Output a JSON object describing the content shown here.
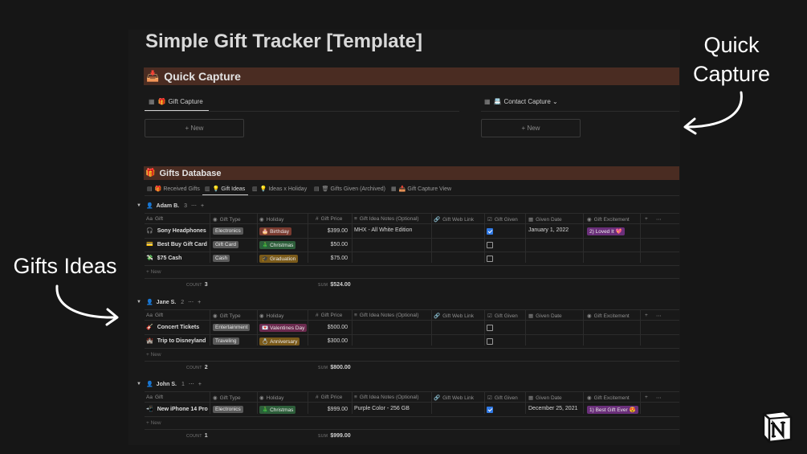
{
  "page": {
    "title": "Simple Gift Tracker [Template]"
  },
  "quick_capture": {
    "heading": "Quick Capture",
    "heading_emoji": "📥",
    "views": [
      {
        "icon": "board-view-icon",
        "emoji": "🎁",
        "label": "Gift Capture",
        "new_label": "+ New"
      },
      {
        "icon": "board-view-icon",
        "emoji": "📇",
        "label": "Contact Capture ⌄",
        "new_label": "+ New"
      }
    ]
  },
  "gifts_database": {
    "heading": "Gifts Database",
    "heading_emoji": "🎁",
    "tabs": [
      {
        "emoji": "🎁",
        "label": "Received Gifts",
        "active": false
      },
      {
        "emoji": "💡",
        "label": "Gift Ideas",
        "active": true
      },
      {
        "emoji": "💡",
        "label": "Ideas x Holiday",
        "active": false
      },
      {
        "emoji": "🗑",
        "label": "Gifts Given (Archived)",
        "active": false
      },
      {
        "emoji": "📥",
        "label": "Gift Capture View",
        "active": false
      }
    ],
    "columns": [
      "Gift",
      "Gift Type",
      "Holiday",
      "Gift Price",
      "Gift Idea Notes (Optional)",
      "Gift Web Link",
      "Gift Given",
      "Given Date",
      "Gift Excitement"
    ],
    "column_prefixes": [
      "Aa",
      "◉",
      "◉",
      "#",
      "≡",
      "🔗",
      "☑",
      "▦",
      "◉"
    ],
    "new_row_label": "+ New",
    "count_label": "COUNT",
    "sum_label": "SUM",
    "groups": [
      {
        "name": "Adam B.",
        "count": "3",
        "rows": [
          {
            "emoji": "🎧",
            "gift": "Sony Headphones",
            "type": "Electronics",
            "holiday_emoji": "🎂",
            "holiday": "Birthday",
            "price": "$399.00",
            "notes": "MHX - All White Edition",
            "given": true,
            "date": "January 1, 2022",
            "excitement": "2) Loved It 💖"
          },
          {
            "emoji": "💳",
            "gift": "Best Buy Gift Card",
            "type": "Gift Card",
            "holiday_emoji": "🎄",
            "holiday": "Christmas",
            "price": "$50.00",
            "notes": "",
            "given": false,
            "date": "",
            "excitement": ""
          },
          {
            "emoji": "💸",
            "gift": "$75 Cash",
            "type": "Cash",
            "holiday_emoji": "🎓",
            "holiday": "Graduation",
            "price": "$75.00",
            "notes": "",
            "given": false,
            "date": "",
            "excitement": ""
          }
        ],
        "count_value": "3",
        "sum_value": "$524.00"
      },
      {
        "name": "Jane S.",
        "count": "2",
        "rows": [
          {
            "emoji": "🎸",
            "gift": "Concert Tickets",
            "type": "Entertainment",
            "holiday_emoji": "💌",
            "holiday": "Valentines Day",
            "price": "$500.00",
            "notes": "",
            "given": false,
            "date": "",
            "excitement": ""
          },
          {
            "emoji": "🏰",
            "gift": "Trip to Disneyland",
            "type": "Traveling",
            "holiday_emoji": "💍",
            "holiday": "Anniversary",
            "price": "$300.00",
            "notes": "",
            "given": false,
            "date": "",
            "excitement": ""
          }
        ],
        "count_value": "2",
        "sum_value": "$800.00"
      },
      {
        "name": "John S.",
        "count": "1",
        "rows": [
          {
            "emoji": "📲",
            "gift": "New iPhone 14 Pro",
            "type": "Electronics",
            "holiday_emoji": "🎄",
            "holiday": "Christmas",
            "price": "$999.00",
            "notes": "Purple Color - 256 GB",
            "given": true,
            "date": "December 25, 2021",
            "excitement": "1) Best Gift Ever 😍"
          }
        ],
        "count_value": "1",
        "sum_value": "$999.00"
      }
    ]
  },
  "annotations": {
    "quick_capture_line1": "Quick",
    "quick_capture_line2": "Capture",
    "gift_ideas": "Gifts Ideas"
  },
  "colors": {
    "background": "#161616",
    "canvas": "#191919",
    "section_header": "#4a2c22",
    "checkbox_checked": "#2f78e3",
    "tag_electronics": "#5a5a5a",
    "tag_holiday_birthday": "#7a3b30",
    "tag_holiday_christmas": "#2d5e3a",
    "tag_holiday_graduation": "#7a5a1a",
    "tag_holiday_valentines": "#6b2a4e",
    "tag_excitement": "#6a2f7a"
  }
}
